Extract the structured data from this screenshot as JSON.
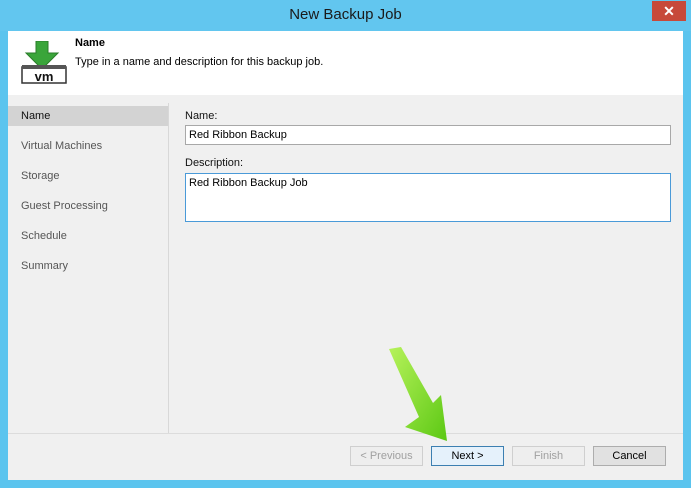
{
  "window": {
    "title": "New Backup Job"
  },
  "header": {
    "title": "Name",
    "description": "Type in a name and description for this backup job.",
    "icon": "vm-backup-icon",
    "icon_text": "vm"
  },
  "sidebar": {
    "items": [
      {
        "label": "Name",
        "active": true
      },
      {
        "label": "Virtual Machines"
      },
      {
        "label": "Storage"
      },
      {
        "label": "Guest Processing"
      },
      {
        "label": "Schedule"
      },
      {
        "label": "Summary"
      }
    ]
  },
  "form": {
    "name_label": "Name:",
    "name_value": "Red Ribbon Backup",
    "description_label": "Description:",
    "description_value": "Red Ribbon Backup Job"
  },
  "buttons": {
    "previous": "< Previous",
    "next": "Next >",
    "finish": "Finish",
    "cancel": "Cancel"
  },
  "colors": {
    "accent": "#5bc4ee",
    "close_button": "#c7493a",
    "annotation_arrow": "#7ddc1f"
  }
}
